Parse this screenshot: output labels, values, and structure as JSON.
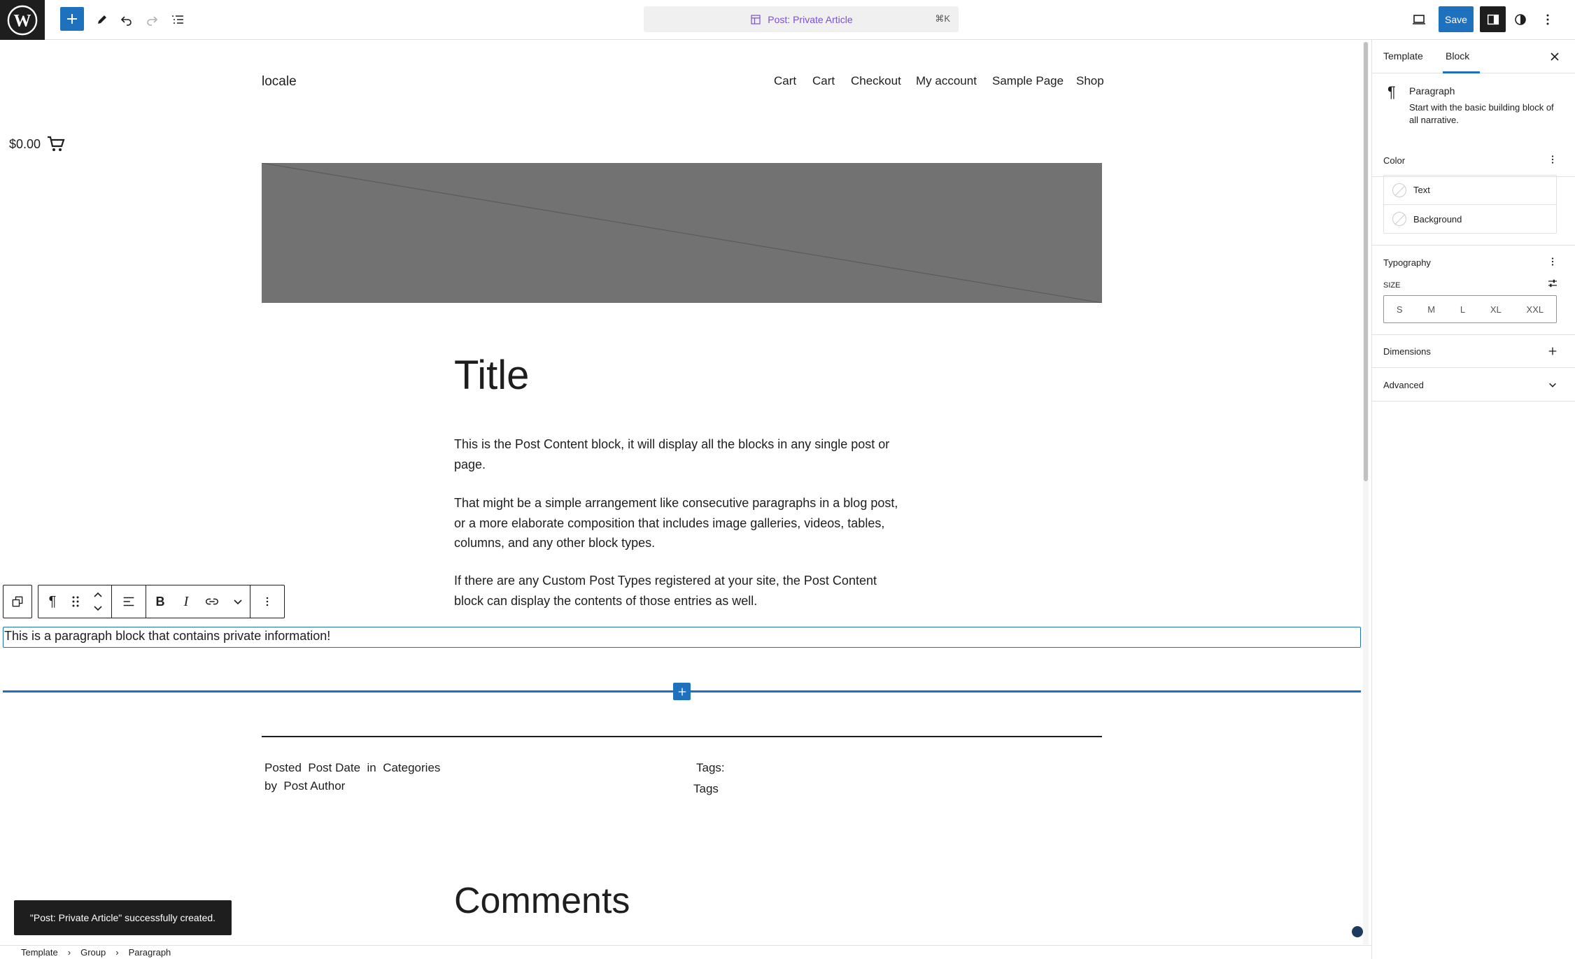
{
  "topbar": {
    "document_title": "Post: Private Article",
    "shortcut": "⌘K",
    "save_label": "Save"
  },
  "site": {
    "title": "locale",
    "nav": [
      "Cart",
      "Cart",
      "Checkout",
      "My account",
      "Sample Page",
      "Shop"
    ],
    "cart_total": "$0.00"
  },
  "post": {
    "title": "Title",
    "paragraphs": [
      "This is the Post Content block, it will display all the blocks in any single post or page.",
      "That might be a simple arrangement like consecutive paragraphs in a blog post, or a more elaborate composition that includes image galleries, videos, tables, columns, and any other block types.",
      "If there are any Custom Post Types registered at your site, the Post Content block can display the contents of those entries as well."
    ],
    "selected_paragraph": "This is a paragraph block that contains private information!",
    "meta": {
      "posted": "Posted",
      "post_date": "Post Date",
      "in": "in",
      "categories": "Categories",
      "by": "by",
      "post_author": "Post Author",
      "tags_label": "Tags:",
      "tags": "Tags"
    },
    "comments_title": "Comments"
  },
  "snackbar": "\"Post: Private Article\" successfully created.",
  "breadcrumb": [
    "Template",
    "Group",
    "Paragraph"
  ],
  "sidebar": {
    "tabs": [
      "Template",
      "Block"
    ],
    "active_tab": "Block",
    "block": {
      "name": "Paragraph",
      "description": "Start with the basic building block of all narrative."
    },
    "color": {
      "title": "Color",
      "items": [
        "Text",
        "Background"
      ]
    },
    "typography": {
      "title": "Typography",
      "size_label": "SIZE",
      "sizes": [
        "S",
        "M",
        "L",
        "XL",
        "XXL"
      ]
    },
    "dimensions_title": "Dimensions",
    "advanced_title": "Advanced"
  },
  "colors": {
    "accent": "#1e72bd",
    "dark": "#1e1e1e",
    "image_placeholder": "#727272",
    "doc_title": "#7b4fd1"
  }
}
